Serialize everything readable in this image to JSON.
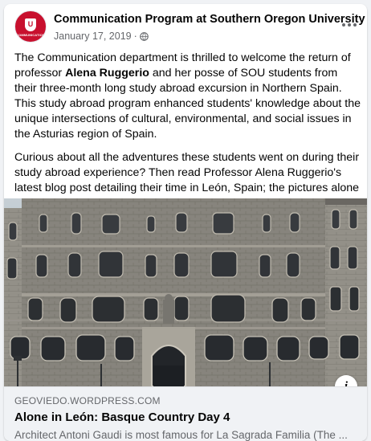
{
  "post": {
    "page_name": "Communication Program at Southern Oregon University",
    "date": "January 17, 2019",
    "separator": "·",
    "privacy_icon": "globe-icon",
    "more_icon": "more-horizontal-icon",
    "avatar": {
      "letter": "U",
      "abbr": "COMMUNICATION",
      "color": "#c8102e"
    },
    "paragraph1": {
      "before": "The Communication department is thrilled to welcome the return of professor ",
      "bold": "Alena Ruggerio",
      "after": " and her posse of SOU students from their three-month long study abroad excursion in Northern Spain. This study abroad program enhanced students' knowledge about the unique intersections of cultural, environmental, and social issues in the Asturias region of Spain."
    },
    "paragraph2": "Curious about all the adventures these students went on during their study abroad experience? Then read Professor Alena Ruggerio's latest blog post detailing their time in León, Spain; the pictures alone are worth the read!"
  },
  "link_preview": {
    "domain": "GEOVIEDO.WORDPRESS.COM",
    "title": "Alone in León: Basque Country Day 4",
    "description": "Architect Antoni Gaudi is most famous for La Sagrada Familia (The ...",
    "info_icon": "info-icon",
    "info_label": "i",
    "image": "building-facade-photo"
  }
}
